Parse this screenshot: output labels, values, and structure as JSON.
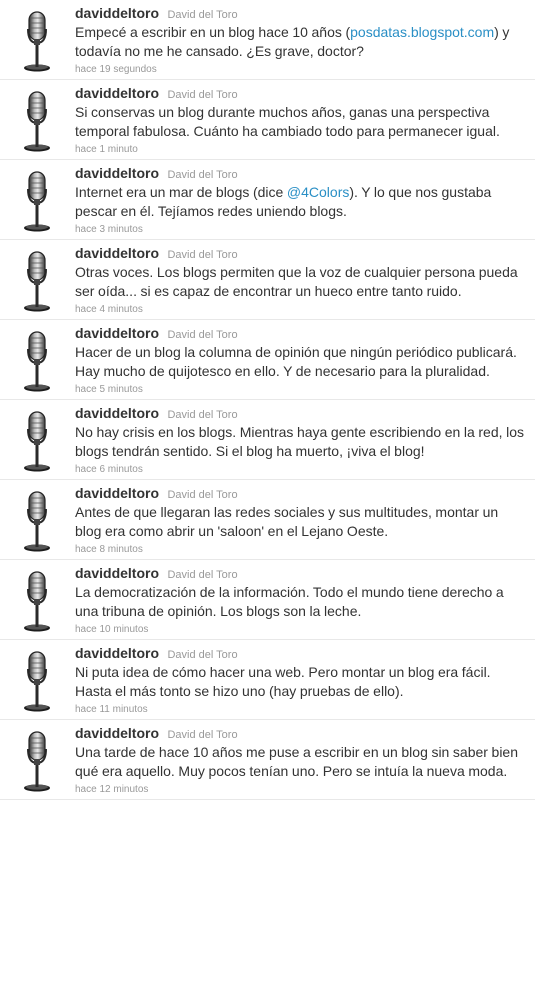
{
  "timeline": {
    "tweets": [
      {
        "handle": "daviddeltoro",
        "fullname": "David del Toro",
        "segments": [
          {
            "text": "Empecé a escribir en un blog hace 10 años ("
          },
          {
            "text": "posdatas.blogspot.com",
            "link": true
          },
          {
            "text": ") y todavía no me he cansado. ¿Es grave, doctor?"
          }
        ],
        "time": "hace 19 segundos"
      },
      {
        "handle": "daviddeltoro",
        "fullname": "David del Toro",
        "segments": [
          {
            "text": "Si conservas un blog durante muchos años, ganas una perspectiva temporal fabulosa. Cuánto ha cambiado todo para permanecer igual."
          }
        ],
        "time": "hace 1 minuto"
      },
      {
        "handle": "daviddeltoro",
        "fullname": "David del Toro",
        "segments": [
          {
            "text": "Internet era un mar de blogs (dice "
          },
          {
            "text": "@4Colors",
            "link": true
          },
          {
            "text": "). Y lo que nos gustaba pescar en él. Tejíamos redes uniendo blogs."
          }
        ],
        "time": "hace 3 minutos"
      },
      {
        "handle": "daviddeltoro",
        "fullname": "David del Toro",
        "segments": [
          {
            "text": "Otras voces. Los blogs permiten que la voz de cualquier persona pueda ser oída... si es capaz de encontrar un hueco entre tanto ruido."
          }
        ],
        "time": "hace 4 minutos"
      },
      {
        "handle": "daviddeltoro",
        "fullname": "David del Toro",
        "segments": [
          {
            "text": "Hacer de un blog la columna de opinión que ningún periódico publicará. Hay mucho de quijotesco en ello. Y de necesario para la pluralidad."
          }
        ],
        "time": "hace 5 minutos"
      },
      {
        "handle": "daviddeltoro",
        "fullname": "David del Toro",
        "segments": [
          {
            "text": "No hay crisis en los blogs. Mientras haya gente escribiendo en la red, los blogs tendrán sentido. Si el blog ha muerto, ¡viva el blog!"
          }
        ],
        "time": "hace 6 minutos"
      },
      {
        "handle": "daviddeltoro",
        "fullname": "David del Toro",
        "segments": [
          {
            "text": "Antes de que llegaran las redes sociales y sus multitudes, montar un blog era como abrir un 'saloon' en el Lejano Oeste."
          }
        ],
        "time": "hace 8 minutos"
      },
      {
        "handle": "daviddeltoro",
        "fullname": "David del Toro",
        "segments": [
          {
            "text": "La democratización de la información. Todo el mundo tiene derecho a una tribuna de opinión. Los blogs son la leche."
          }
        ],
        "time": "hace 10 minutos"
      },
      {
        "handle": "daviddeltoro",
        "fullname": "David del Toro",
        "segments": [
          {
            "text": "Ni puta idea de cómo hacer una web. Pero montar un blog era fácil. Hasta el más tonto se hizo uno (hay pruebas de ello)."
          }
        ],
        "time": "hace 11 minutos"
      },
      {
        "handle": "daviddeltoro",
        "fullname": "David del Toro",
        "segments": [
          {
            "text": "Una tarde de hace 10 años me puse a escribir en un blog sin saber bien qué era aquello. Muy pocos tenían uno. Pero se intuía la nueva moda."
          }
        ],
        "time": "hace 12 minutos"
      }
    ]
  },
  "colors": {
    "link": "#2a8fc5",
    "text": "#333333",
    "muted": "#999999",
    "divider": "#e8e8e8"
  },
  "icons": {
    "avatar": "microphone-icon"
  }
}
